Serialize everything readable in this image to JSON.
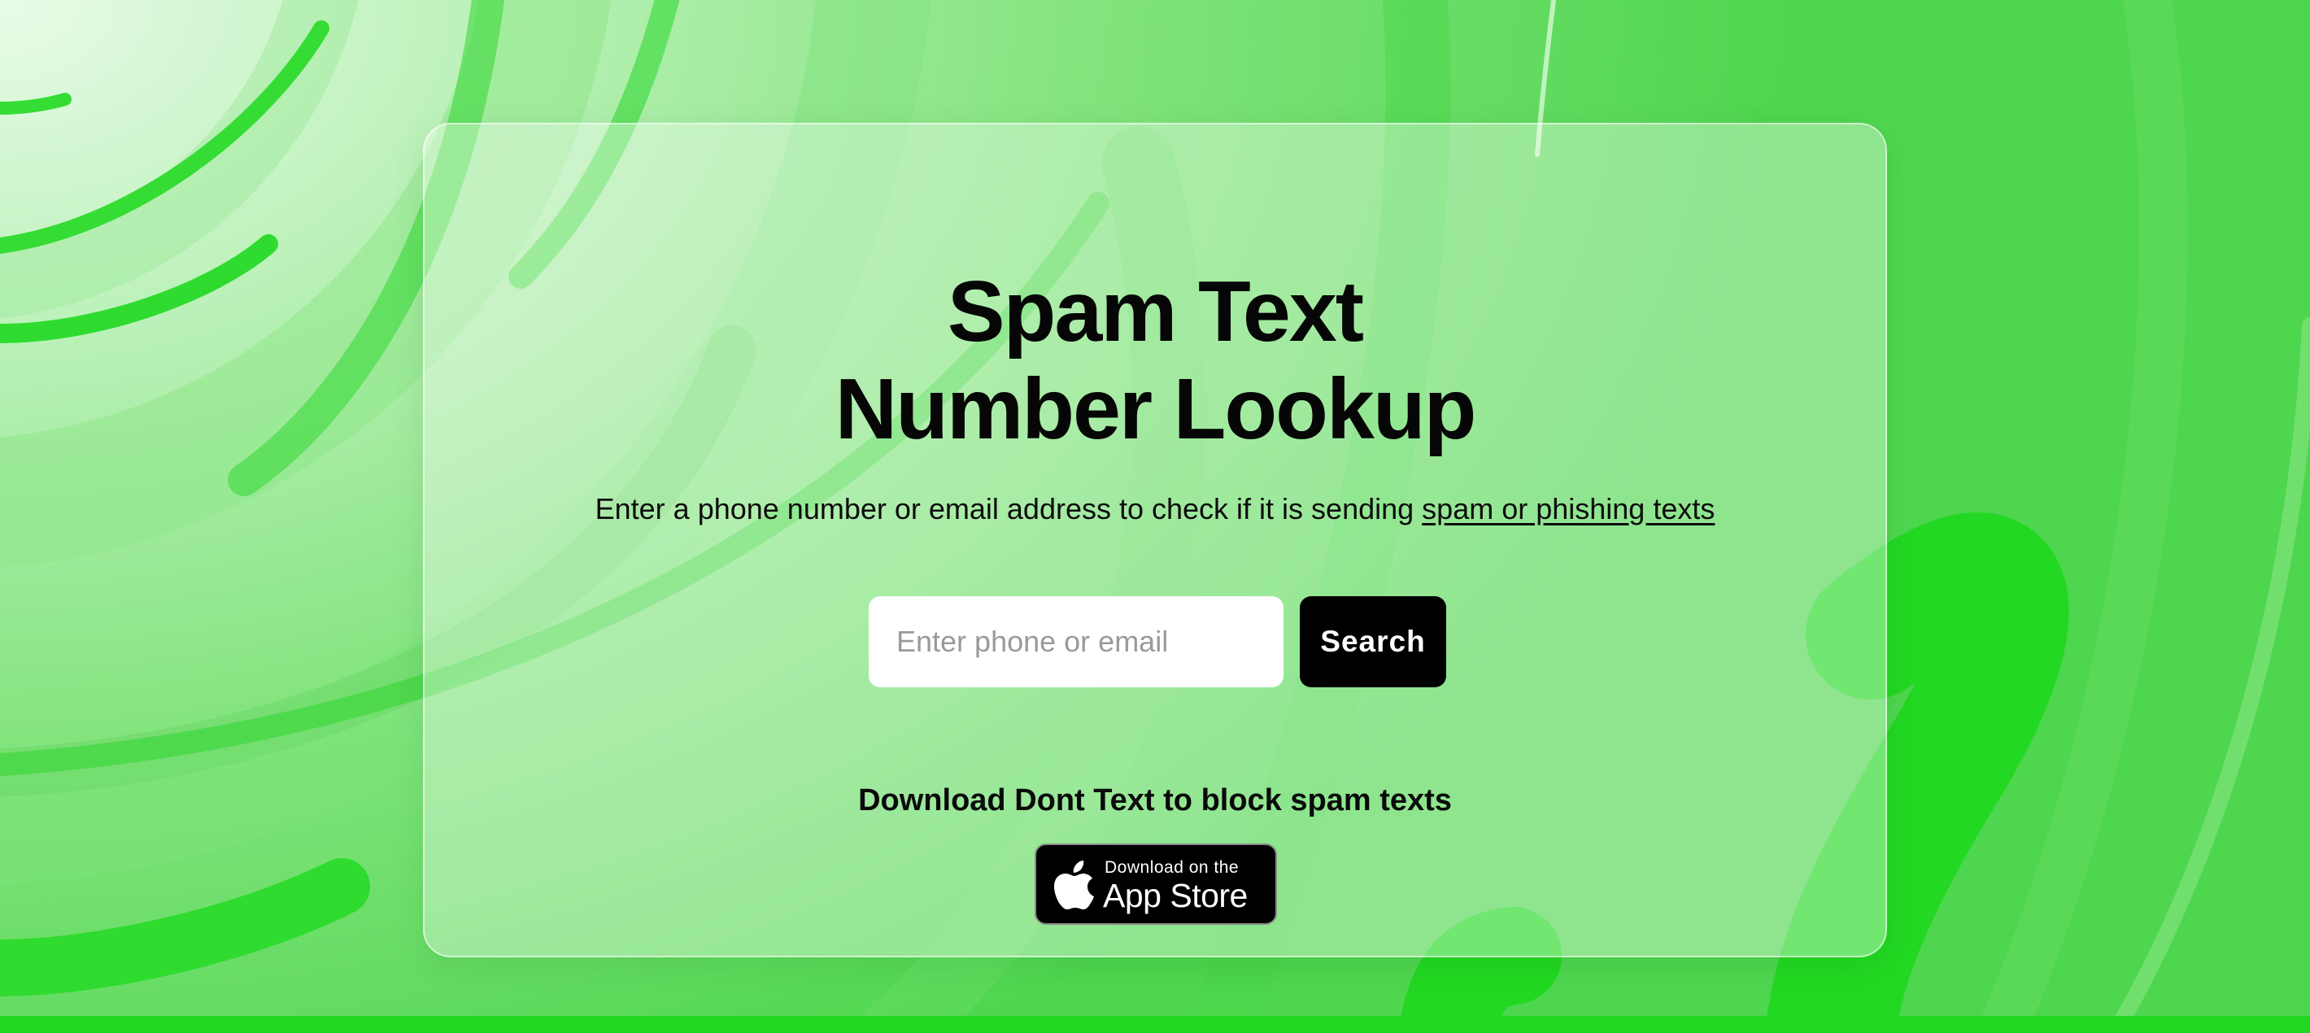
{
  "hero": {
    "title_line1": "Spam Text",
    "title_line2": "Number Lookup",
    "subtitle_text": "Enter a phone number or email address to check if it is sending ",
    "subtitle_link": "spam or phishing texts"
  },
  "search": {
    "placeholder": "Enter phone or email",
    "value": "",
    "button_label": "Search"
  },
  "promo": {
    "text": "Download Dont Text to block spam texts"
  },
  "app_store_badge": {
    "small_text": "Download on the",
    "big_text": "App Store",
    "icon": "apple-icon"
  },
  "colors": {
    "background_green": "#54d654",
    "accent_green": "#22d822",
    "button_black": "#000000"
  }
}
